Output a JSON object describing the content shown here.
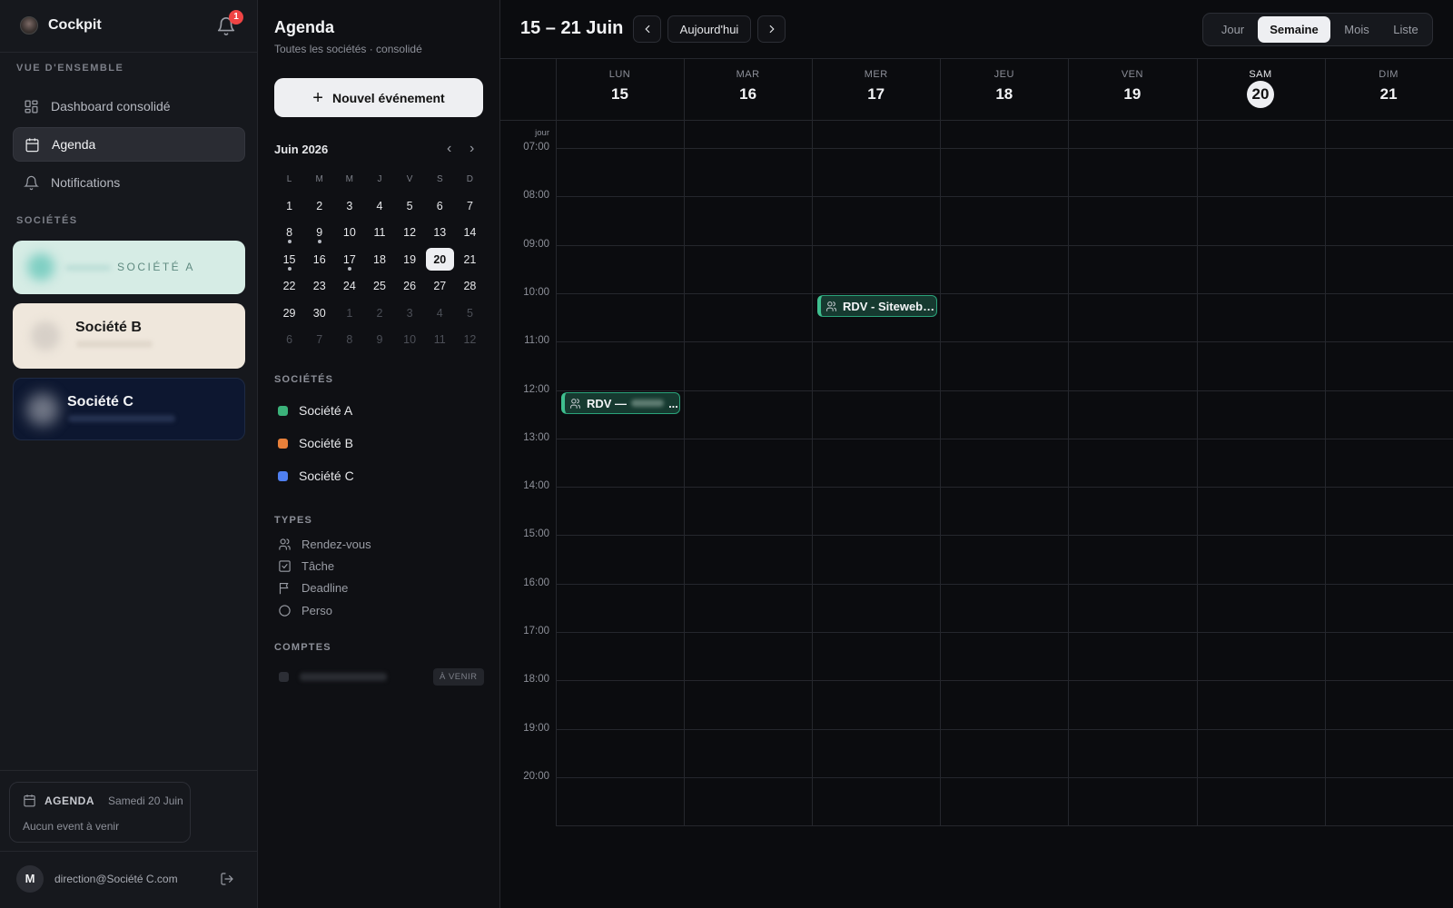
{
  "app": {
    "name": "Cockpit",
    "notification_count": "1"
  },
  "sidebar": {
    "overview_section": "VUE D'ENSEMBLE",
    "nav": [
      {
        "label": "Dashboard consolidé",
        "icon": "dashboard-icon"
      },
      {
        "label": "Agenda",
        "icon": "calendar-icon",
        "active": true
      },
      {
        "label": "Notifications",
        "icon": "bell-icon"
      }
    ],
    "companies_section": "SOCIÉTÉS",
    "company_cards": [
      {
        "label": "SOCIÉTÉ A",
        "bg": "#d6ece5"
      },
      {
        "label": "Société B",
        "bg": "#efe7dc"
      },
      {
        "label": "Société C",
        "bg": "#0d1730"
      }
    ],
    "agenda_widget": {
      "title": "AGENDA",
      "date": "Samedi 20 Juin",
      "empty": "Aucun event à venir"
    },
    "user": {
      "initial": "M",
      "email": "direction@Société C.com"
    }
  },
  "panel": {
    "title": "Agenda",
    "subtitle": "Toutes les sociétés · consolidé",
    "new_event_label": "Nouvel événement",
    "mini_calendar": {
      "month": "Juin 2026",
      "weekdays": [
        "L",
        "M",
        "M",
        "J",
        "V",
        "S",
        "D"
      ],
      "days": [
        "1",
        "2",
        "3",
        "4",
        "5",
        "6",
        "7",
        "8",
        "9",
        "10",
        "11",
        "12",
        "13",
        "14",
        "15",
        "16",
        "17",
        "18",
        "19",
        "20",
        "21",
        "22",
        "23",
        "24",
        "25",
        "26",
        "27",
        "28",
        "29",
        "30",
        "1",
        "2",
        "3",
        "4",
        "5",
        "6",
        "7",
        "8",
        "9",
        "10",
        "11",
        "12"
      ],
      "today": "20",
      "dot_days": [
        "8",
        "9",
        "15",
        "17"
      ]
    },
    "companies_section": "SOCIÉTÉS",
    "companies": [
      {
        "label": "Société A",
        "color": "#3bb27a"
      },
      {
        "label": "Société B",
        "color": "#e8803a"
      },
      {
        "label": "Société C",
        "color": "#4f7ff0"
      }
    ],
    "types_section": "TYPES",
    "types": [
      {
        "label": "Rendez-vous",
        "icon": "users-icon"
      },
      {
        "label": "Tâche",
        "icon": "checkbox-icon"
      },
      {
        "label": "Deadline",
        "icon": "flag-icon"
      },
      {
        "label": "Perso",
        "icon": "circle-icon"
      }
    ],
    "accounts_section": "COMPTES",
    "account_badge": "À VENIR"
  },
  "calendar": {
    "range_title": "15 – 21 Juin",
    "today_button": "Aujourd'hui",
    "views": [
      "Jour",
      "Semaine",
      "Mois",
      "Liste"
    ],
    "active_view": "Semaine",
    "days": [
      {
        "dow": "LUN",
        "num": "15"
      },
      {
        "dow": "MAR",
        "num": "16"
      },
      {
        "dow": "MER",
        "num": "17"
      },
      {
        "dow": "JEU",
        "num": "18"
      },
      {
        "dow": "VEN",
        "num": "19"
      },
      {
        "dow": "SAM",
        "num": "20",
        "today": true
      },
      {
        "dow": "DIM",
        "num": "21"
      }
    ],
    "allday_label": "jour",
    "hours": [
      "07:00",
      "08:00",
      "09:00",
      "10:00",
      "11:00",
      "12:00",
      "13:00",
      "14:00",
      "15:00",
      "16:00",
      "17:00",
      "18:00",
      "19:00",
      "20:00"
    ],
    "events": [
      {
        "title": "RDV - Siteweb…",
        "day": "MER 17",
        "start": "10:00",
        "color": "#3fbf8f"
      },
      {
        "title": "RDV —",
        "suffix": "...",
        "day": "LUN 15",
        "start": "12:00",
        "color": "#3fbf8f"
      }
    ]
  }
}
